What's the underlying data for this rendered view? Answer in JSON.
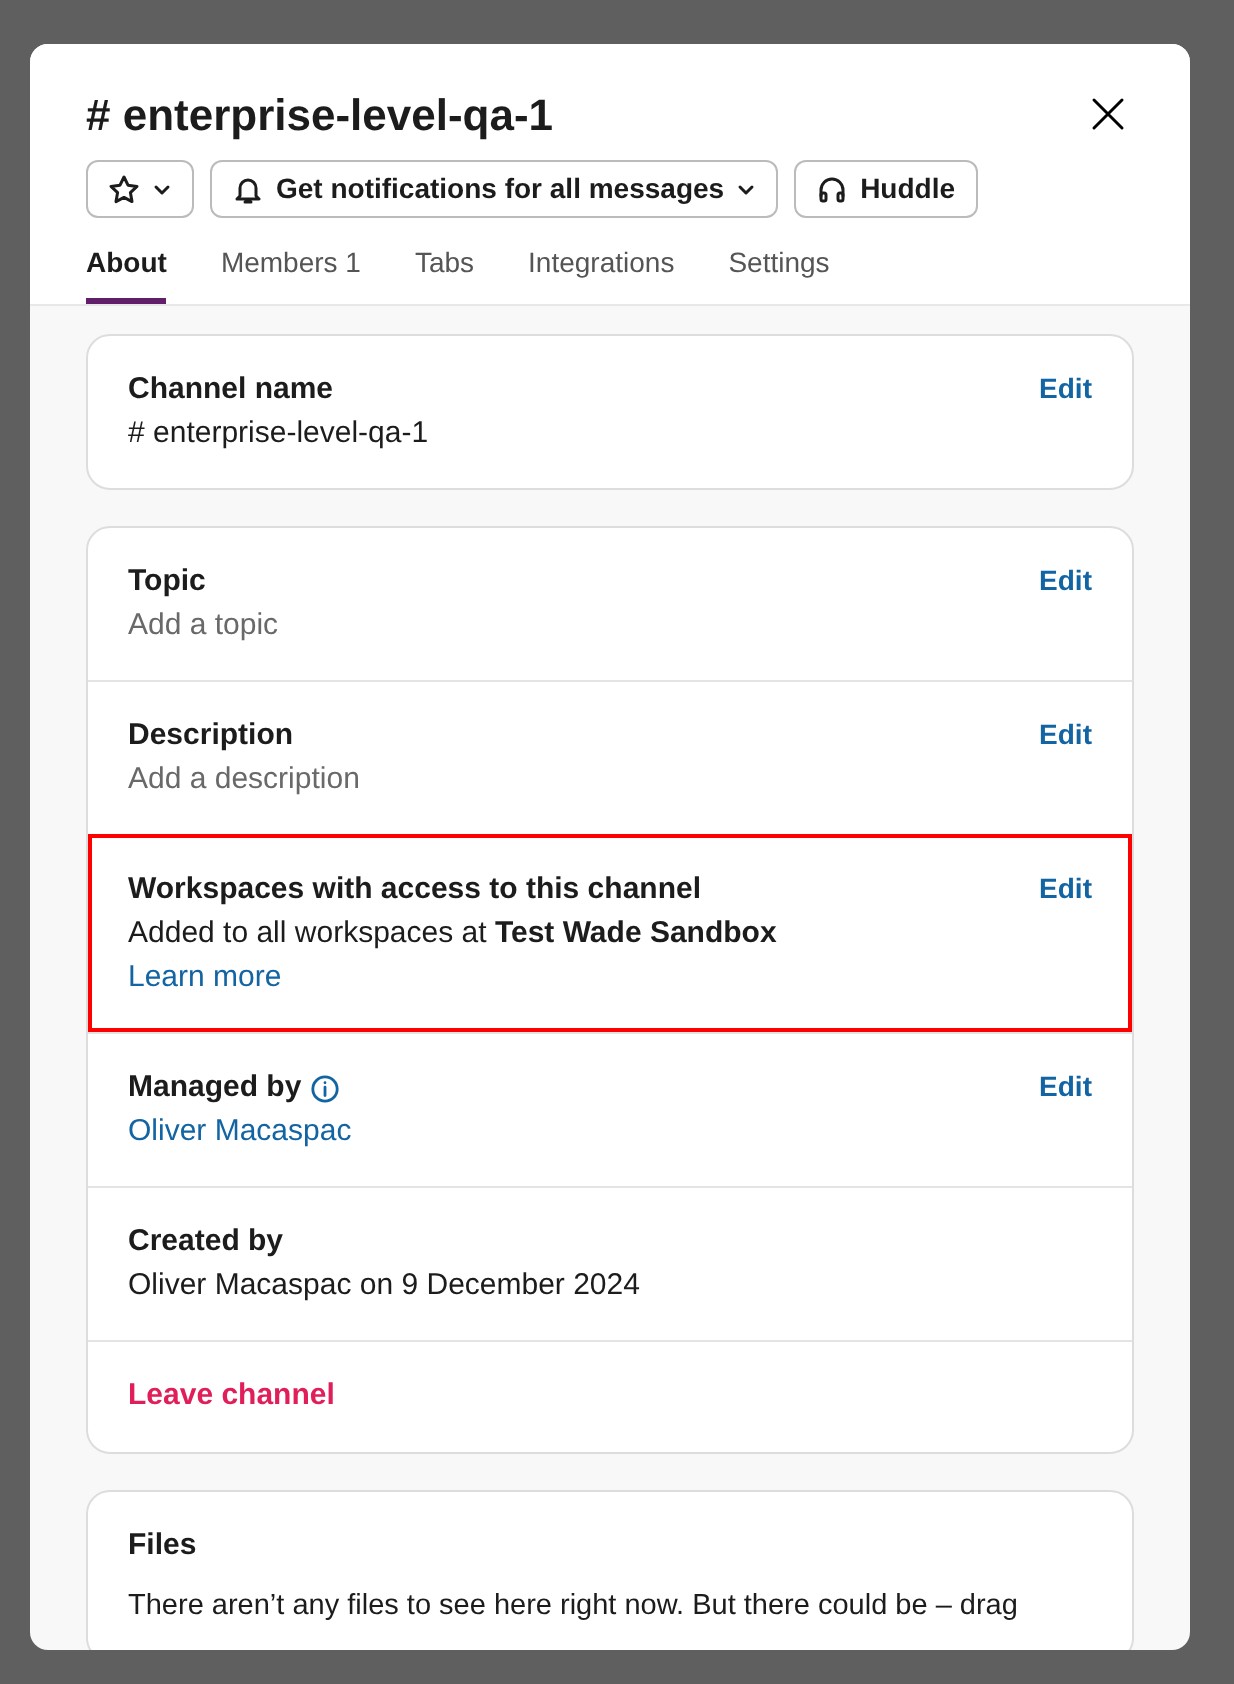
{
  "dialog": {
    "title": "# enterprise-level-qa-1",
    "actions": [
      {
        "kind": "star",
        "caret": true
      },
      {
        "kind": "bell",
        "label": "Get notifications for all messages",
        "caret": true
      },
      {
        "kind": "headphones",
        "label": "Huddle"
      }
    ],
    "tabs": [
      {
        "label": "About",
        "selected": true
      },
      {
        "label": "Members",
        "count": "1",
        "selected": false
      },
      {
        "label": "Tabs",
        "selected": false
      },
      {
        "label": "Integrations",
        "selected": false
      },
      {
        "label": "Settings",
        "selected": false
      }
    ],
    "cards": [
      {
        "sections": [
          {
            "kind": "field",
            "title": "Channel name",
            "edit": "Edit",
            "lines": [
              {
                "kind": "plain",
                "text": "# enterprise-level-qa-1"
              }
            ]
          }
        ]
      },
      {
        "sections": [
          {
            "kind": "field",
            "title": "Topic",
            "edit": "Edit",
            "lines": [
              {
                "kind": "muted",
                "text": "Add a topic"
              }
            ]
          },
          {
            "kind": "field",
            "title": "Description",
            "edit": "Edit",
            "lines": [
              {
                "kind": "muted",
                "text": "Add a description"
              }
            ]
          },
          {
            "kind": "field",
            "title": "Workspaces with access to this channel",
            "edit": "Edit",
            "highlighted": true,
            "lines": [
              {
                "kind": "plain",
                "text": "Added to all workspaces at **Test Wade Sandbox**"
              },
              {
                "kind": "link",
                "text": "Learn more"
              }
            ]
          },
          {
            "kind": "field",
            "title": "Managed by",
            "info": true,
            "edit": "Edit",
            "lines": [
              {
                "kind": "link",
                "text": "Oliver Macaspac"
              }
            ]
          },
          {
            "kind": "field",
            "title": "Created by",
            "lines": [
              {
                "kind": "plain",
                "text": "Oliver Macaspac on 9 December 2024"
              }
            ]
          },
          {
            "kind": "danger",
            "text": "Leave channel"
          }
        ]
      },
      {
        "sections": [
          {
            "kind": "field",
            "title": "Files",
            "lines": [
              {
                "kind": "plain",
                "text": "There aren’t any files to see here right now. But there could be – drag"
              }
            ]
          }
        ]
      }
    ]
  }
}
